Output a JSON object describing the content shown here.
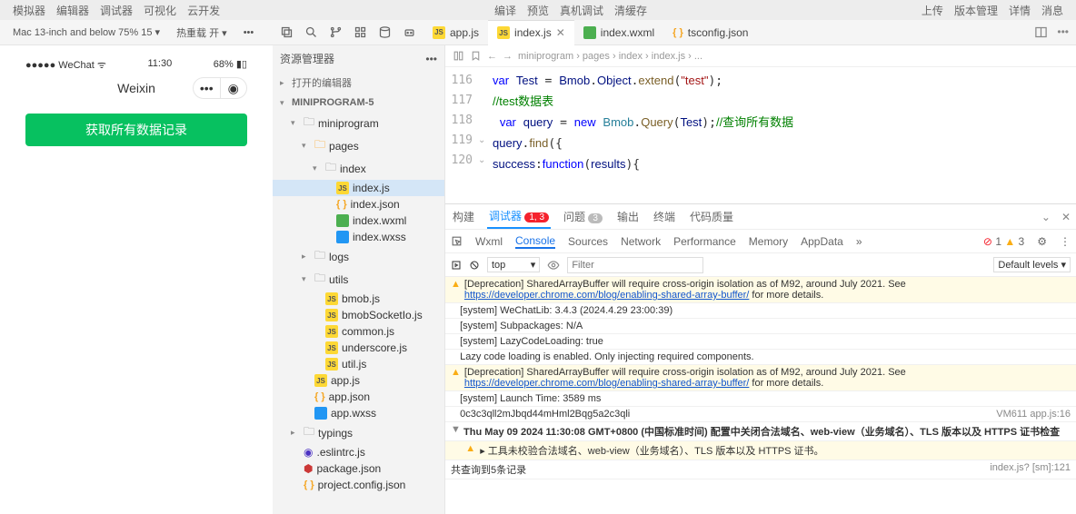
{
  "menus": {
    "left": [
      "模拟器",
      "编辑器",
      "调试器",
      "可视化",
      "云开发"
    ],
    "mid": [
      "编译",
      "预览",
      "真机调试",
      "清缓存"
    ],
    "right": [
      "上传",
      "版本管理",
      "详情",
      "消息"
    ]
  },
  "simbar": {
    "device": "Mac 13-inch and below 75% 15 ▾",
    "hot": "热重载 开 ▾"
  },
  "tabs": [
    {
      "label": "app.js",
      "icon": "js"
    },
    {
      "label": "index.js",
      "icon": "js",
      "active": true
    },
    {
      "label": "index.wxml",
      "icon": "wxml"
    },
    {
      "label": "tsconfig.json",
      "icon": "json"
    }
  ],
  "explorer": {
    "title": "资源管理器",
    "open_editors": "打开的编辑器",
    "project": "MINIPROGRAM-5"
  },
  "tree": [
    {
      "d": 1,
      "chev": "▾",
      "icon": "folder",
      "label": "miniprogram"
    },
    {
      "d": 2,
      "chev": "▾",
      "icon": "pages",
      "label": "pages"
    },
    {
      "d": 3,
      "chev": "▾",
      "icon": "folder",
      "label": "index"
    },
    {
      "d": 4,
      "icon": "js",
      "label": "index.js",
      "sel": true
    },
    {
      "d": 4,
      "icon": "json",
      "label": "index.json"
    },
    {
      "d": 4,
      "icon": "wxml",
      "label": "index.wxml"
    },
    {
      "d": 4,
      "icon": "wxss",
      "label": "index.wxss"
    },
    {
      "d": 2,
      "chev": "▸",
      "icon": "folder",
      "label": "logs"
    },
    {
      "d": 2,
      "chev": "▾",
      "icon": "folder",
      "label": "utils"
    },
    {
      "d": 3,
      "icon": "js",
      "label": "bmob.js"
    },
    {
      "d": 3,
      "icon": "js",
      "label": "bmobSocketIo.js"
    },
    {
      "d": 3,
      "icon": "js",
      "label": "common.js"
    },
    {
      "d": 3,
      "icon": "js",
      "label": "underscore.js"
    },
    {
      "d": 3,
      "icon": "js",
      "label": "util.js"
    },
    {
      "d": 2,
      "icon": "js",
      "label": "app.js"
    },
    {
      "d": 2,
      "icon": "json",
      "label": "app.json"
    },
    {
      "d": 2,
      "icon": "wxss",
      "label": "app.wxss"
    },
    {
      "d": 1,
      "chev": "▸",
      "icon": "folder",
      "label": "typings"
    },
    {
      "d": 1,
      "icon": "eslint",
      "label": ".eslintrc.js"
    },
    {
      "d": 1,
      "icon": "npm",
      "label": "package.json"
    },
    {
      "d": 1,
      "icon": "json",
      "label": "project.config.json"
    }
  ],
  "sim": {
    "carrier": "●●●●● WeChat",
    "wifi": "⌃",
    "time": "11:30",
    "battery": "68%",
    "title": "Weixin",
    "btn": "获取所有数据记录"
  },
  "crumbs": [
    "miniprogram",
    "pages",
    "index",
    "index.js",
    "..."
  ],
  "code": {
    "start": 116,
    "lines": [
      "<span class='kw'>var</span> <span class='var'>Test</span> = <span class='var'>Bmob</span>.<span class='var'>Object</span>.<span class='fn'>extend</span>(<span class='str'>\"test\"</span>);",
      "<span class='com'>//test数据表</span>",
      " <span class='kw'>var</span> <span class='var'>query</span> = <span class='kw'>new</span> <span class='cls'>Bmob</span>.<span class='fn'>Query</span>(<span class='var'>Test</span>);<span class='com'>//查询所有数据</span>",
      "<span class='var'>query</span>.<span class='fn'>find</span>({",
      "<span class='var'>success</span>:<span class='kw'>function</span>(<span class='var'>results</span>){"
    ]
  },
  "dt": {
    "tabs": [
      "构建",
      "调试器",
      "问题",
      "输出",
      "终端",
      "代码质量"
    ],
    "badge1": "1, 3",
    "badge2": "3",
    "sub": [
      "Wxml",
      "Console",
      "Sources",
      "Network",
      "Performance",
      "Memory",
      "AppData"
    ],
    "err": "1",
    "warn": "3",
    "filter": {
      "ctx": "top",
      "ph": "Filter",
      "lvl": "Default levels ▾"
    },
    "logs": [
      {
        "t": "warn",
        "msg": "[Deprecation] SharedArrayBuffer will require cross-origin isolation as of M92, around July 2021. See",
        "link": "https://developer.chrome.com/blog/enabling-shared-array-buffer/",
        "after": " for more details."
      },
      {
        "t": "log",
        "msg": "[system] WeChatLib: 3.4.3 (2024.4.29 23:00:39)"
      },
      {
        "t": "log",
        "msg": "[system] Subpackages: N/A"
      },
      {
        "t": "log",
        "msg": "[system] LazyCodeLoading: true"
      },
      {
        "t": "log",
        "msg": "Lazy code loading is enabled. Only injecting required components."
      },
      {
        "t": "warn",
        "msg": "[Deprecation] SharedArrayBuffer will require cross-origin isolation as of M92, around July 2021. See",
        "link": "https://developer.chrome.com/blog/enabling-shared-array-buffer/",
        "after": " for more details."
      },
      {
        "t": "log",
        "msg": "[system] Launch Time: 3589 ms"
      },
      {
        "t": "log",
        "msg": "0c3c3qll2mJbqd44mHml2Bqg5a2c3qli",
        "right": "VM611 app.js:16"
      },
      {
        "t": "group",
        "msg": "Thu May 09 2024 11:30:08 GMT+0800 (中国标准时间) 配置中关闭合法域名、web-view（业务域名）、TLS 版本以及 HTTPS 证书检查"
      },
      {
        "t": "warn",
        "indent": true,
        "msg": "▸ 工具未校验合法域名、web-view（业务域名）、TLS 版本以及 HTTPS 证书。"
      },
      {
        "t": "sum",
        "msg": "共查询到5条记录",
        "right": "index.js? [sm]:121"
      }
    ]
  }
}
